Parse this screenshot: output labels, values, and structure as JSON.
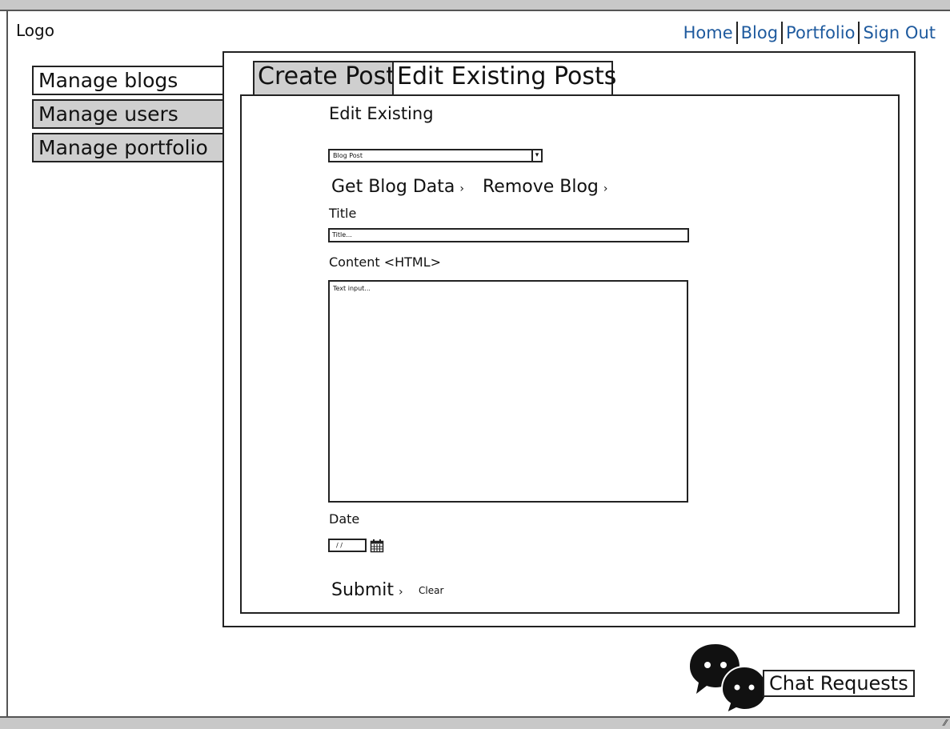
{
  "header": {
    "logo": "Logo",
    "nav": [
      "Home",
      "Blog",
      "Portfolio",
      "Sign Out"
    ],
    "link_color": "#1e5a9e"
  },
  "sidebar": {
    "items": [
      {
        "label": "Manage blogs",
        "active": true
      },
      {
        "label": "Manage users",
        "active": false
      },
      {
        "label": "Manage portfolio",
        "active": false
      }
    ]
  },
  "tabs": [
    {
      "label": "Create Post",
      "active": false
    },
    {
      "label": "Edit Existing Posts",
      "active": true
    }
  ],
  "form": {
    "heading": "Edit Existing",
    "select": {
      "value": "Blog Post",
      "icon": "chevron-down-icon"
    },
    "get_blog_label": "Get Blog Data",
    "remove_blog_label": "Remove Blog",
    "title_label": "Title",
    "title_placeholder": "Title...",
    "content_label": "Content <HTML>",
    "content_placeholder": "Text input...",
    "date_label": "Date",
    "date_placeholder": "/ /",
    "submit_label": "Submit",
    "clear_label": "Clear"
  },
  "chat": {
    "label": "Chat Requests",
    "icon": "chat-bubbles-icon"
  }
}
